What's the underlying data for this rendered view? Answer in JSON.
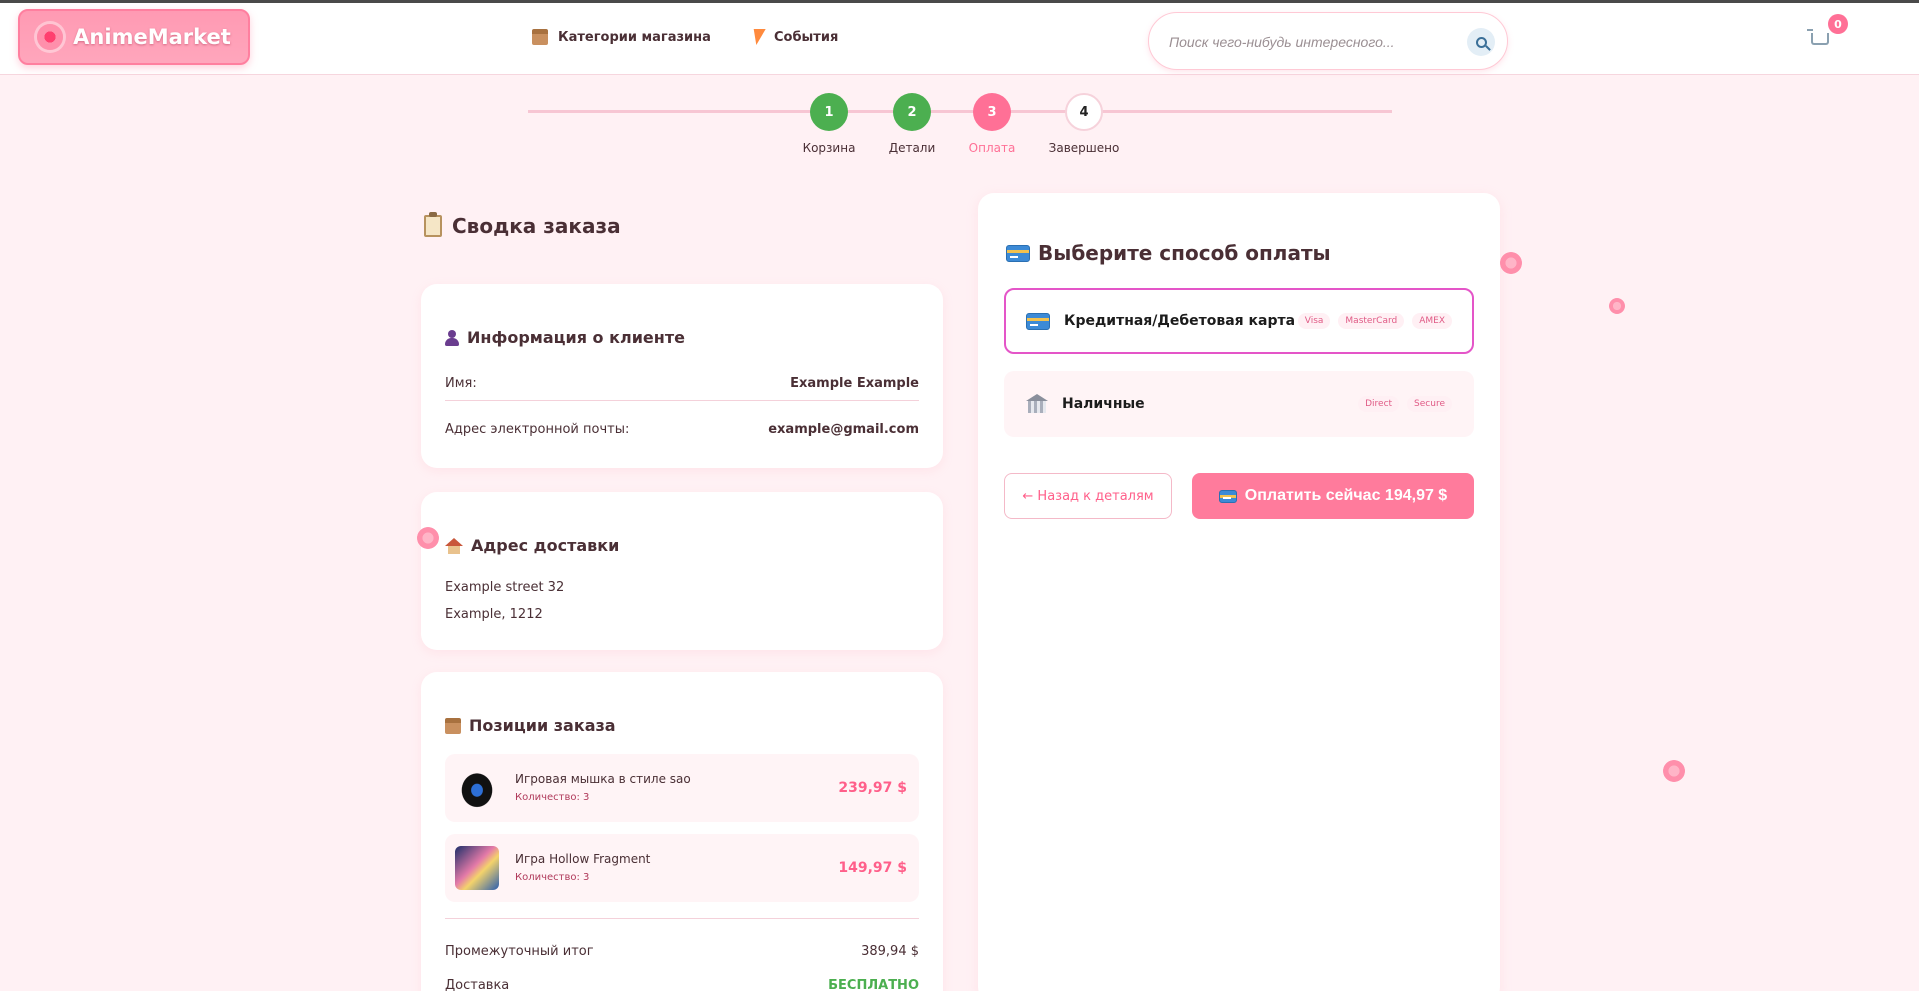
{
  "header": {
    "logo": "AnimeMarket",
    "nav": [
      {
        "label": "Категории магазина",
        "icon": "box-icon"
      },
      {
        "label": "События",
        "icon": "lightning-icon"
      }
    ],
    "search_placeholder": "Поиск чего-нибудь интересного...",
    "cart_count": "0"
  },
  "steps": [
    {
      "number": "1",
      "label": "Корзина",
      "state": "done"
    },
    {
      "number": "2",
      "label": "Детали",
      "state": "done"
    },
    {
      "number": "3",
      "label": "Оплата",
      "state": "active"
    },
    {
      "number": "4",
      "label": "Завершено",
      "state": "todo"
    }
  ],
  "summary": {
    "title": "Сводка заказа",
    "client": {
      "title": "Информация о клиенте",
      "name_label": "Имя:",
      "name_value": "Example Example",
      "email_label": "Адрес электронной почты:",
      "email_value": "example@gmail.com"
    },
    "delivery": {
      "title": "Адрес доставки",
      "line1": "Example street 32",
      "line2": "Example, 1212"
    },
    "items": {
      "title": "Позиции заказа",
      "list": [
        {
          "name": "Игровая мышка в стиле sao",
          "qty": "Количество: 3",
          "price": "239,97 $"
        },
        {
          "name": "Игра Hollow Fragment",
          "qty": "Количество: 3",
          "price": "149,97 $"
        }
      ],
      "subtotal_label": "Промежуточный итог",
      "subtotal_value": "389,94 $",
      "shipping_label": "Доставка",
      "shipping_value": "БЕСПЛАТНО"
    }
  },
  "payment": {
    "title": "Выберите способ оплаты",
    "methods": [
      {
        "label": "Кредитная/Дебетовая карта",
        "chips": [
          "Visa",
          "MasterCard",
          "AMEX"
        ],
        "selected": true
      },
      {
        "label": "Наличные",
        "chips": [
          "Direct",
          "Secure"
        ],
        "selected": false
      }
    ],
    "back_label": "← Назад к деталям",
    "pay_label": "Оплатить сейчас 194,97 $"
  },
  "colors": {
    "accent": "#ff7096",
    "success": "#4caf50",
    "background": "#fff1f4",
    "selected_border": "#e455c8"
  }
}
